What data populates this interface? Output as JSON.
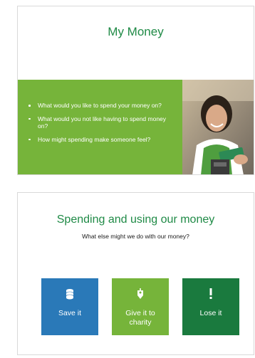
{
  "slide1": {
    "title": "My Money",
    "bullets": [
      "What would you like to spend your money on?",
      "What would you not like having to spend money on?",
      "How might spending make someone feel?"
    ]
  },
  "slide2": {
    "title": "Spending and using our money",
    "subtitle": "What else might we do with our money?",
    "tiles": [
      {
        "label": "Save it",
        "icon": "coin-stack-icon",
        "color": "#2a79b8"
      },
      {
        "label": "Give it to charity",
        "icon": "charity-tag-icon",
        "color": "#76b43a"
      },
      {
        "label": "Lose it",
        "icon": "exclamation-icon",
        "color": "#1a7a3e"
      }
    ]
  },
  "colors": {
    "title_green": "#1f8a46",
    "panel_green": "#76b43a"
  }
}
